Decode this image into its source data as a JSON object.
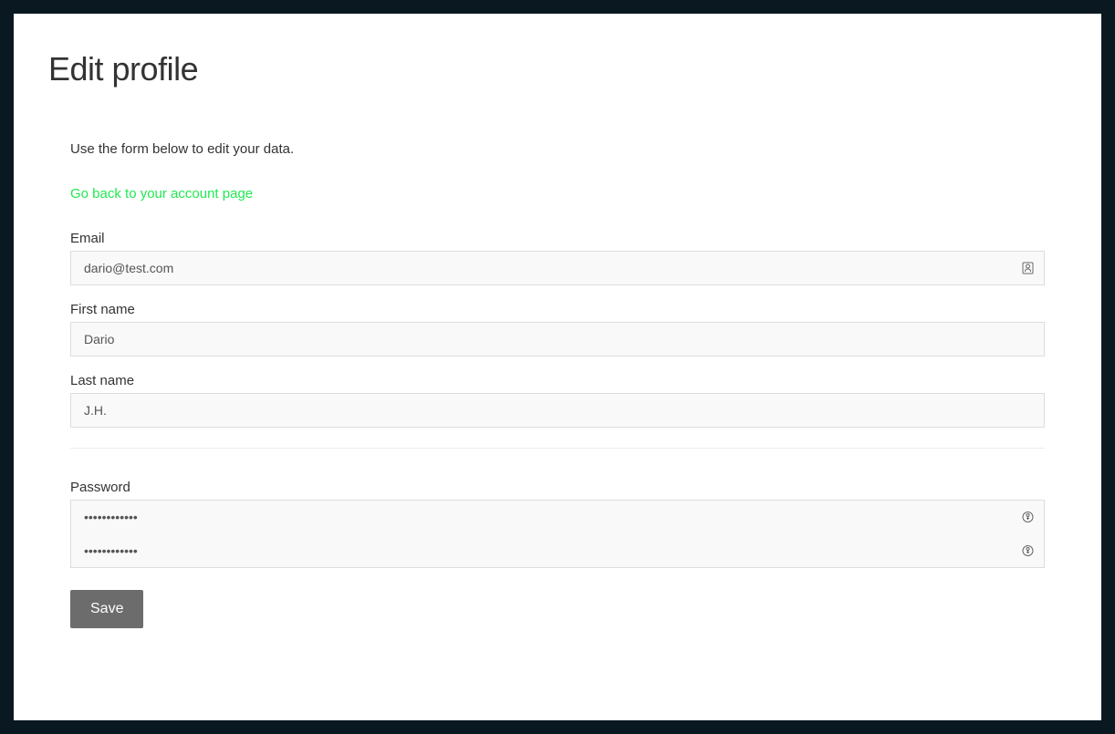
{
  "page": {
    "title": "Edit profile",
    "intro": "Use the form below to edit your data.",
    "back_link": "Go back to your account page"
  },
  "form": {
    "email": {
      "label": "Email",
      "value": "dario@test.com"
    },
    "first_name": {
      "label": "First name",
      "value": "Dario"
    },
    "last_name": {
      "label": "Last name",
      "value": "J.H."
    },
    "password": {
      "label": "Password",
      "value1": "••••••••••••",
      "value2": "••••••••••••"
    },
    "save_button": "Save"
  }
}
